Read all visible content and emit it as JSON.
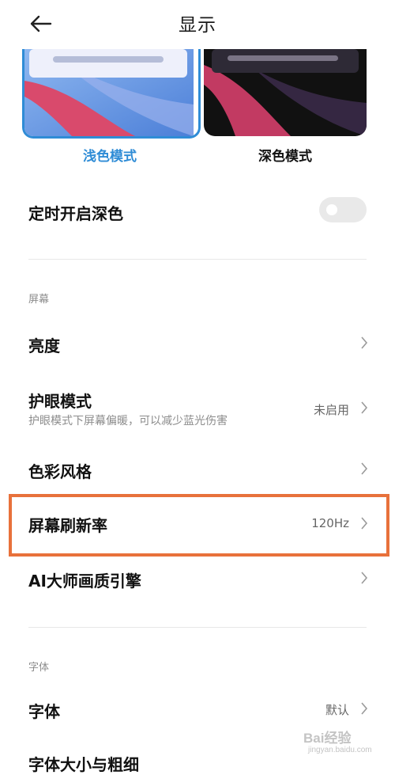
{
  "header": {
    "title": "显示"
  },
  "themes": {
    "light": {
      "label": "浅色模式",
      "selected": true
    },
    "dark": {
      "label": "深色模式",
      "selected": false
    }
  },
  "schedule_dark": {
    "label": "定时开启深色",
    "enabled": false
  },
  "sections": {
    "screen": {
      "label": "屏幕",
      "items": [
        {
          "title": "亮度",
          "value": ""
        },
        {
          "title": "护眼模式",
          "subtitle": "护眼模式下屏幕偏暖，可以减少蓝光伤害",
          "value": "未启用"
        },
        {
          "title": "色彩风格",
          "value": ""
        },
        {
          "title": "屏幕刷新率",
          "value": "120Hz"
        },
        {
          "title": "AI大师画质引擎",
          "value": ""
        }
      ]
    },
    "font": {
      "label": "字体",
      "items": [
        {
          "title": "字体",
          "value": "默认"
        },
        {
          "title": "字体大小与粗细",
          "value": ""
        }
      ]
    }
  },
  "watermark": {
    "text": "Bai经验",
    "url": "jingyan.baidu.com"
  },
  "colors": {
    "accent": "#2f8cd6",
    "highlight": "#e8713b",
    "toggle_off": "#e9e9e9"
  }
}
